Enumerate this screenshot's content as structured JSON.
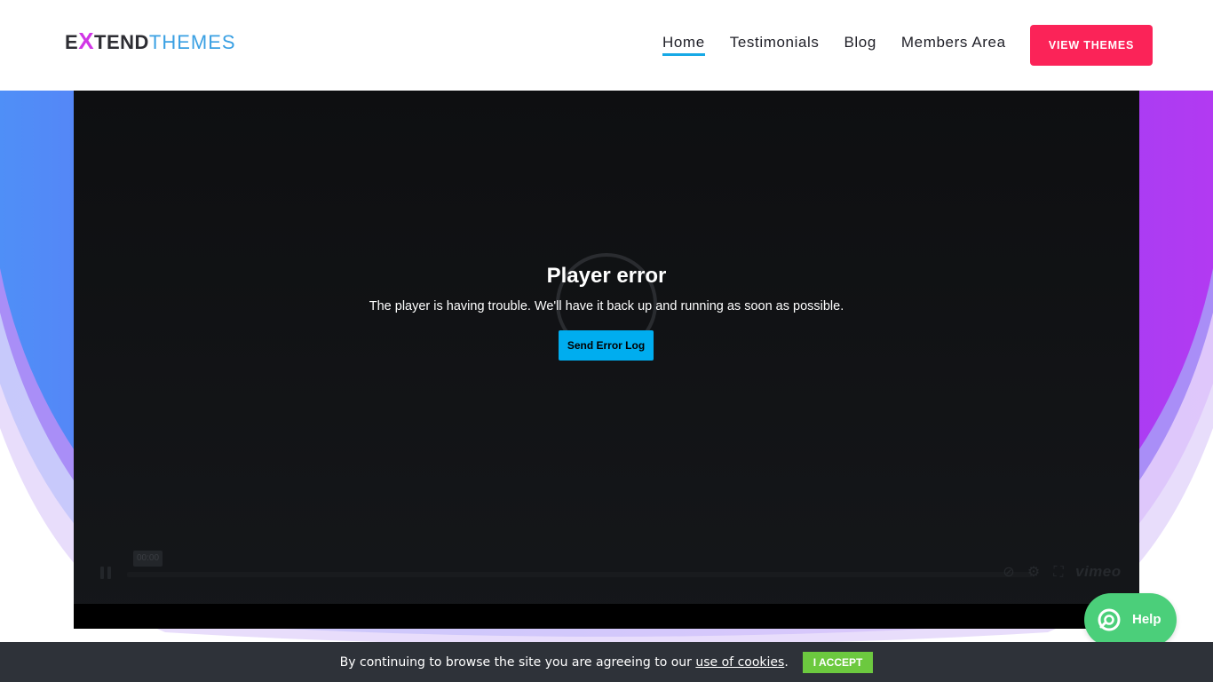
{
  "header": {
    "logo": {
      "part1": "E",
      "part_x": "X",
      "part2": "TEND",
      "part3": "THEMES"
    },
    "nav": [
      {
        "label": "Home",
        "active": true
      },
      {
        "label": "Testimonials",
        "active": false
      },
      {
        "label": "Blog",
        "active": false
      },
      {
        "label": "Members Area",
        "active": false
      }
    ],
    "cta_label": "VIEW THEMES"
  },
  "player": {
    "error_title": "Player error",
    "error_message": "The player is having trouble. We'll have it back up and running as soon as possible.",
    "error_button": "Send Error Log",
    "time": "00:00",
    "brand": "vimeo",
    "icons": [
      "pause-icon",
      "no-hd-icon",
      "settings-icon",
      "fullscreen-icon"
    ]
  },
  "help": {
    "label": "Help",
    "icon": "lifebuoy-icon"
  },
  "cookie": {
    "text_before": "By continuing to browse the site you are agreeing to our ",
    "link": "use of cookies",
    "text_after": ".",
    "accept_label": "I ACCEPT"
  },
  "colors": {
    "accent_blue": "#17a9e6",
    "cta_pink": "#fb2358",
    "hero_gradient": [
      "#4f8ff7",
      "#8b3cf7",
      "#b23af2"
    ],
    "help_green": "#4bcf7a",
    "cookie_accept": "#6cc93f"
  }
}
